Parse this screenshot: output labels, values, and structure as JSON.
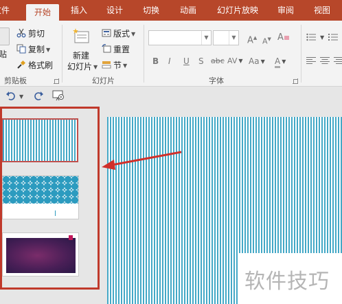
{
  "menu": {
    "tabs": [
      "文件",
      "开始",
      "插入",
      "设计",
      "切换",
      "动画",
      "幻灯片放映",
      "审阅",
      "视图"
    ],
    "active_index": 1
  },
  "ribbon": {
    "clipboard": {
      "paste_label": "贴",
      "cut_label": "剪切",
      "copy_label": "复制",
      "format_painter_label": "格式刷",
      "group_label": "剪贴板"
    },
    "slides": {
      "new_slide_line1": "新建",
      "new_slide_line2": "幻灯片",
      "layout_label": "版式",
      "reset_label": "重置",
      "section_label": "节",
      "group_label": "幻灯片"
    },
    "font": {
      "font_name_value": "",
      "font_size_value": "",
      "bold_label": "B",
      "italic_label": "I",
      "underline_label": "U",
      "strike_label": "S",
      "shadow_label": "abc",
      "spacing_label": "AV",
      "case_label": "Aa",
      "grow_label": "A",
      "shrink_label": "A",
      "clear_label": "A",
      "color_label": "A",
      "group_label": "字体"
    }
  },
  "watermark": {
    "text": "软件技巧"
  },
  "colors": {
    "accent": "#b7472a",
    "highlight": "#c0392b",
    "stripe": "#43a8c6"
  }
}
